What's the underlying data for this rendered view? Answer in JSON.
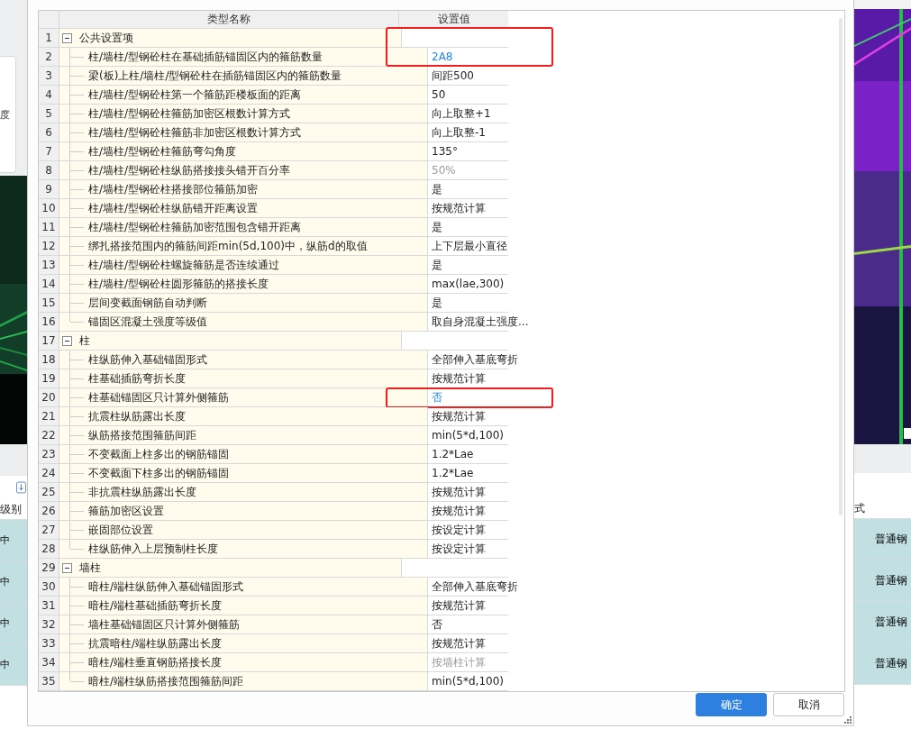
{
  "background": {
    "left": {
      "card_text": "度",
      "column_header": "级别",
      "cells": [
        "中",
        "中",
        "中",
        "中"
      ]
    },
    "right": {
      "column_header": "式",
      "cells": [
        "普通钢",
        "普通钢",
        "普通钢",
        "普通钢"
      ]
    }
  },
  "table": {
    "columns": [
      "类型名称",
      "设置值"
    ],
    "groups": [
      {
        "num": "1",
        "label": "公共设置项",
        "expanded": true,
        "children": [
          {
            "num": "2",
            "label": "柱/墙柱/型钢砼柱在基础插筋锚固区内的箍筋数量",
            "value": "2A8",
            "modified": true,
            "disabled": false,
            "highlighted": true
          },
          {
            "num": "3",
            "label": "梁(板)上柱/墙柱/型钢砼柱在插筋锚固区内的箍筋数量",
            "value": "间距500",
            "modified": false,
            "disabled": false,
            "highlighted": false
          },
          {
            "num": "4",
            "label": "柱/墙柱/型钢砼柱第一个箍筋距楼板面的距离",
            "value": "50",
            "modified": false,
            "disabled": false,
            "highlighted": false
          },
          {
            "num": "5",
            "label": "柱/墙柱/型钢砼柱箍筋加密区根数计算方式",
            "value": "向上取整+1",
            "modified": false,
            "disabled": false,
            "highlighted": false
          },
          {
            "num": "6",
            "label": "柱/墙柱/型钢砼柱箍筋非加密区根数计算方式",
            "value": "向上取整-1",
            "modified": false,
            "disabled": false,
            "highlighted": false
          },
          {
            "num": "7",
            "label": "柱/墙柱/型钢砼柱箍筋弯勾角度",
            "value": "135°",
            "modified": false,
            "disabled": false,
            "highlighted": false
          },
          {
            "num": "8",
            "label": "柱/墙柱/型钢砼柱纵筋搭接接头错开百分率",
            "value": "50%",
            "modified": false,
            "disabled": true,
            "highlighted": false
          },
          {
            "num": "9",
            "label": "柱/墙柱/型钢砼柱搭接部位箍筋加密",
            "value": "是",
            "modified": false,
            "disabled": false,
            "highlighted": false
          },
          {
            "num": "10",
            "label": "柱/墙柱/型钢砼柱纵筋错开距离设置",
            "value": "按规范计算",
            "modified": false,
            "disabled": false,
            "highlighted": false
          },
          {
            "num": "11",
            "label": "柱/墙柱/型钢砼柱箍筋加密范围包含错开距离",
            "value": "是",
            "modified": false,
            "disabled": false,
            "highlighted": false
          },
          {
            "num": "12",
            "label": "绑扎搭接范围内的箍筋间距min(5d,100)中，纵筋d的取值",
            "value": "上下层最小直径",
            "modified": false,
            "disabled": false,
            "highlighted": false
          },
          {
            "num": "13",
            "label": "柱/墙柱/型钢砼柱螺旋箍筋是否连续通过",
            "value": "是",
            "modified": false,
            "disabled": false,
            "highlighted": false
          },
          {
            "num": "14",
            "label": "柱/墙柱/型钢砼柱圆形箍筋的搭接长度",
            "value": "max(lae,300)",
            "modified": false,
            "disabled": false,
            "highlighted": false
          },
          {
            "num": "15",
            "label": "层间变截面钢筋自动判断",
            "value": "是",
            "modified": false,
            "disabled": false,
            "highlighted": false
          },
          {
            "num": "16",
            "label": "锚固区混凝土强度等级值",
            "value": "取自身混凝土强度...",
            "modified": false,
            "disabled": false,
            "highlighted": false
          }
        ]
      },
      {
        "num": "17",
        "label": "柱",
        "expanded": true,
        "children": [
          {
            "num": "18",
            "label": "柱纵筋伸入基础锚固形式",
            "value": "全部伸入基底弯折",
            "modified": false,
            "disabled": false,
            "highlighted": false
          },
          {
            "num": "19",
            "label": "柱基础插筋弯折长度",
            "value": "按规范计算",
            "modified": false,
            "disabled": false,
            "highlighted": false
          },
          {
            "num": "20",
            "label": "柱基础锚固区只计算外侧箍筋",
            "value": "否",
            "modified": true,
            "disabled": false,
            "highlighted": true
          },
          {
            "num": "21",
            "label": "抗震柱纵筋露出长度",
            "value": "按规范计算",
            "modified": false,
            "disabled": false,
            "highlighted": false
          },
          {
            "num": "22",
            "label": "纵筋搭接范围箍筋间距",
            "value": "min(5*d,100)",
            "modified": false,
            "disabled": false,
            "highlighted": false
          },
          {
            "num": "23",
            "label": "不变截面上柱多出的钢筋锚固",
            "value": "1.2*Lae",
            "modified": false,
            "disabled": false,
            "highlighted": false
          },
          {
            "num": "24",
            "label": "不变截面下柱多出的钢筋锚固",
            "value": "1.2*Lae",
            "modified": false,
            "disabled": false,
            "highlighted": false
          },
          {
            "num": "25",
            "label": "非抗震柱纵筋露出长度",
            "value": "按规范计算",
            "modified": false,
            "disabled": false,
            "highlighted": false
          },
          {
            "num": "26",
            "label": "箍筋加密区设置",
            "value": "按规范计算",
            "modified": false,
            "disabled": false,
            "highlighted": false
          },
          {
            "num": "27",
            "label": "嵌固部位设置",
            "value": "按设定计算",
            "modified": false,
            "disabled": false,
            "highlighted": false
          },
          {
            "num": "28",
            "label": "柱纵筋伸入上层预制柱长度",
            "value": "按设定计算",
            "modified": false,
            "disabled": false,
            "highlighted": false
          }
        ]
      },
      {
        "num": "29",
        "label": "墙柱",
        "expanded": true,
        "children": [
          {
            "num": "30",
            "label": "暗柱/端柱纵筋伸入基础锚固形式",
            "value": "全部伸入基底弯折",
            "modified": false,
            "disabled": false,
            "highlighted": false
          },
          {
            "num": "31",
            "label": "暗柱/端柱基础插筋弯折长度",
            "value": "按规范计算",
            "modified": false,
            "disabled": false,
            "highlighted": false
          },
          {
            "num": "32",
            "label": "墙柱基础锚固区只计算外侧箍筋",
            "value": "否",
            "modified": false,
            "disabled": false,
            "highlighted": false
          },
          {
            "num": "33",
            "label": "抗震暗柱/端柱纵筋露出长度",
            "value": "按规范计算",
            "modified": false,
            "disabled": false,
            "highlighted": false
          },
          {
            "num": "34",
            "label": "暗柱/端柱垂直钢筋搭接长度",
            "value": "按墙柱计算",
            "modified": false,
            "disabled": true,
            "highlighted": false
          },
          {
            "num": "35",
            "label": "暗柱/端柱纵筋搭接范围箍筋间距",
            "value": "min(5*d,100)",
            "modified": false,
            "disabled": false,
            "highlighted": false
          }
        ]
      }
    ]
  },
  "buttons": [
    {
      "label": "确定",
      "primary": true
    },
    {
      "label": "取消",
      "primary": false
    }
  ]
}
